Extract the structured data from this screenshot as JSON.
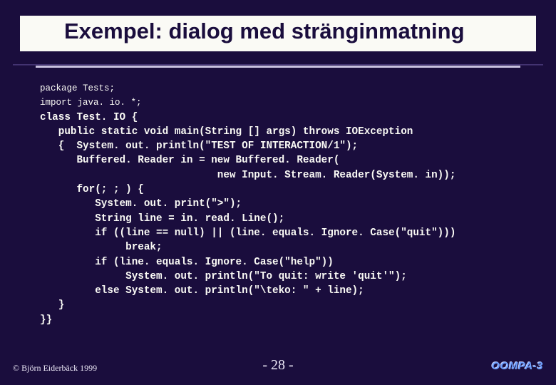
{
  "title": "Exempel: dialog med stränginmatning",
  "code": {
    "l01": "package Tests;",
    "l02": "import java. io. *;",
    "l03": "class Test. IO {",
    "l04": "   public static void main(String [] args) throws IOException",
    "l05": "   {  System. out. println(\"TEST OF INTERACTION/1\");",
    "l06": "      Buffered. Reader in = new Buffered. Reader(",
    "l07": "                             new Input. Stream. Reader(System. in));",
    "l08": "      for(; ; ) {",
    "l09": "         System. out. print(\">\");",
    "l10": "         String line = in. read. Line();",
    "l11": "         if ((line == null) || (line. equals. Ignore. Case(\"quit\")))",
    "l12": "              break;",
    "l13": "         if (line. equals. Ignore. Case(\"help\"))",
    "l14": "              System. out. println(\"To quit: write 'quit'\");",
    "l15": "         else System. out. println(\"\\teko: \" + line);",
    "l16": "   }",
    "l17": "}}"
  },
  "footer": {
    "copyright": "© Björn Eiderbäck 1999",
    "page": "- 28 -",
    "brand": "OOMPA-3"
  }
}
